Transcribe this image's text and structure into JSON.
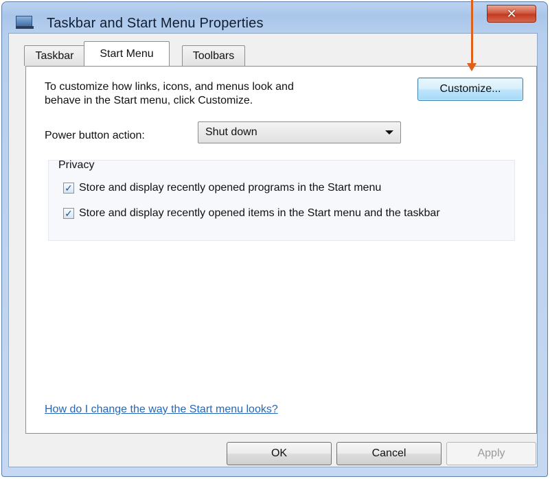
{
  "window": {
    "title": "Taskbar and Start Menu Properties",
    "close_label": "✕",
    "app_icon": "taskbar-icon"
  },
  "tabs": [
    {
      "label": "Taskbar",
      "active": false
    },
    {
      "label": "Start Menu",
      "active": true
    },
    {
      "label": "Toolbars",
      "active": false
    }
  ],
  "start_menu": {
    "intro": "To customize how links, icons, and menus look and\nbehave in the Start menu, click Customize.",
    "customize_label": "Customize...",
    "power_label": "Power button action:",
    "power_value": "Shut down",
    "privacy": {
      "title": "Privacy",
      "options": [
        {
          "label": "Store and display recently opened programs in the Start menu",
          "checked": true
        },
        {
          "label": "Store and display recently opened items in the Start menu and the taskbar",
          "checked": true
        }
      ]
    },
    "help_link": "How do I change the way the Start menu looks?"
  },
  "footer": {
    "ok_label": "OK",
    "cancel_label": "Cancel",
    "apply_label": "Apply"
  },
  "annotation": {
    "color": "#e0601a",
    "target": "Customize..."
  },
  "colors": {
    "link": "#2566b8",
    "close_button": "#c23b22",
    "title_bar": "#a9c6ea"
  }
}
